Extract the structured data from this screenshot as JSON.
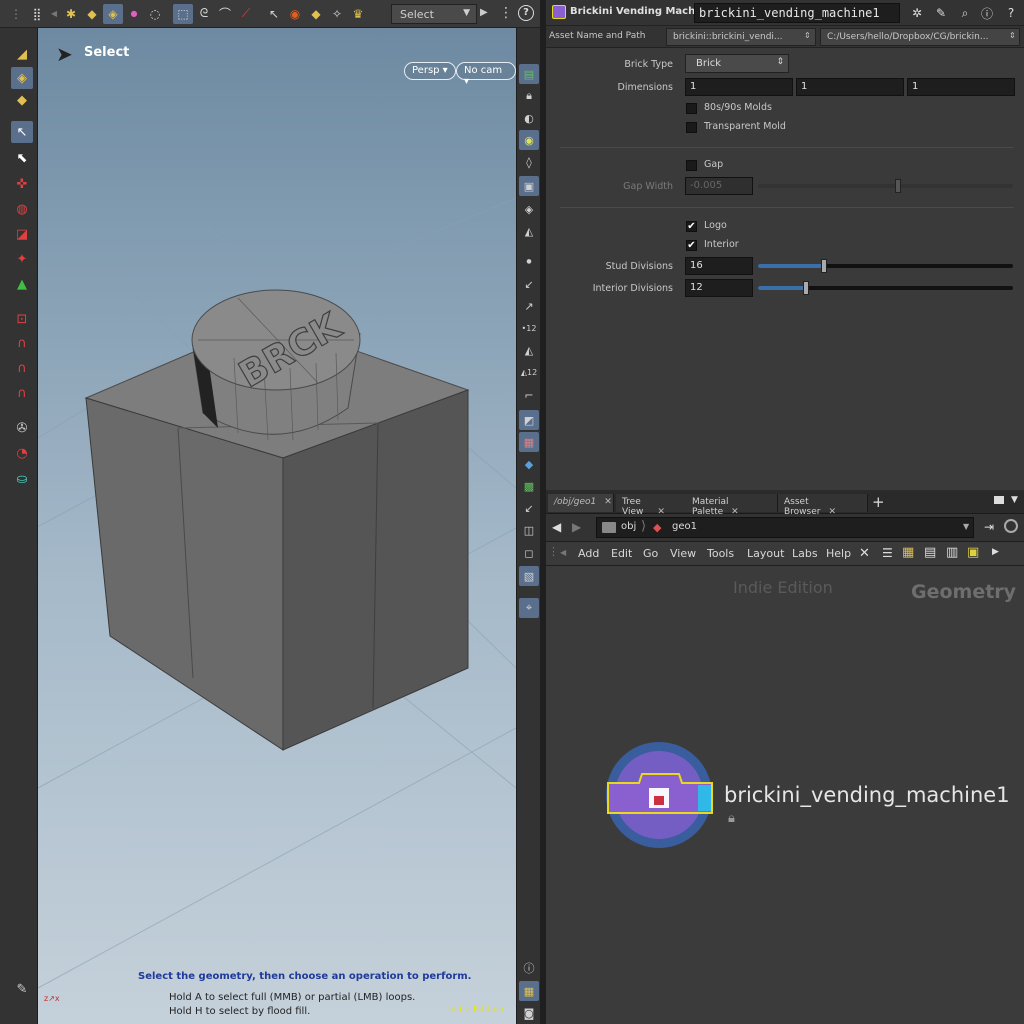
{
  "toolbar": {
    "select_mode": "Select"
  },
  "viewport": {
    "tool_name": "Select",
    "persp_label": "Persp",
    "cam_label": "No cam",
    "brick_text": "BRCK",
    "hint_main": "Select the geometry, then choose an operation to perform.",
    "hint_a": "Hold A to select full (MMB) or partial (LMB) loops.",
    "hint_h": "Hold H to select by flood fill.",
    "indie": "Indie Edition"
  },
  "params": {
    "node_type_title": "Brickini Vending Machine",
    "node_name": "brickini_vending_machine1",
    "asset_label": "Asset Name and Path",
    "asset_name": "brickini::brickini_vendi...",
    "asset_path": "C:/Users/hello/Dropbox/CG/brickin...",
    "brick_type_label": "Brick Type",
    "brick_type_value": "Brick",
    "dimensions_label": "Dimensions",
    "dimensions": [
      "1",
      "1",
      "1"
    ],
    "molds_label": "80s/90s Molds",
    "transparent_label": "Transparent Mold",
    "gap_label": "Gap",
    "gap_width_label": "Gap Width",
    "gap_width_value": "-0.005",
    "logo_label": "Logo",
    "interior_label": "Interior",
    "stud_div_label": "Stud Divisions",
    "stud_div_value": "16",
    "stud_div_fraction": 0.26,
    "interior_div_label": "Interior Divisions",
    "interior_div_value": "12",
    "interior_div_fraction": 0.19,
    "gap_width_fraction": 0.55,
    "molds_checked": false,
    "transparent_checked": false,
    "gap_checked": false,
    "logo_checked": true,
    "interior_checked": true
  },
  "network": {
    "tabs": [
      "/obj/geo1",
      "Tree View",
      "Material Palette",
      "Asset Browser"
    ],
    "path_obj": "obj",
    "path_geo": "geo1",
    "menu": [
      "Add",
      "Edit",
      "Go",
      "View",
      "Tools",
      "Layout",
      "Labs",
      "Help"
    ],
    "watermark": "Indie Edition",
    "context": "Geometry",
    "node_label": "brickini_vending_machine1"
  },
  "icons": {
    "accent": "#5a6f8c",
    "node_outer": "#3a5d9e",
    "node_inner": "#8a5fcf",
    "node_border": "#e8d820",
    "node_cap": "#2fb8e8"
  }
}
